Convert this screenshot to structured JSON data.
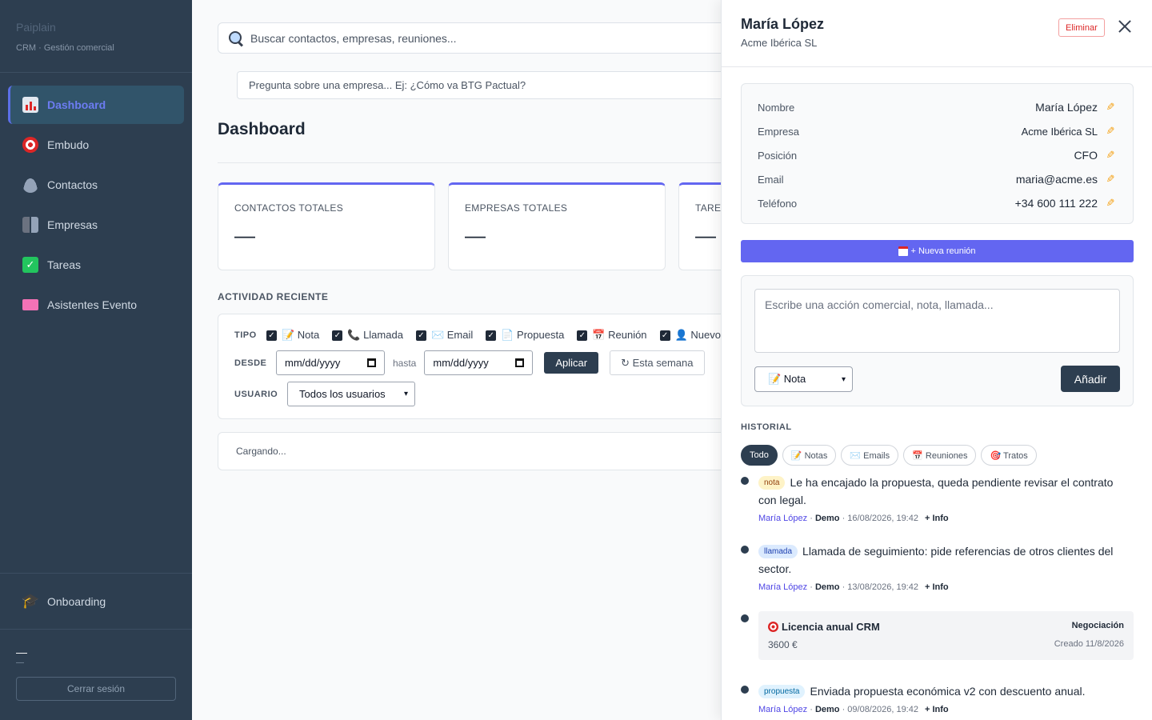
{
  "brand": {
    "title": "Paiplain",
    "subtitle": "CRM · Gestión comercial"
  },
  "sidebar": {
    "items": [
      {
        "label": "Dashboard",
        "icon": "chart-icon",
        "active": true
      },
      {
        "label": "Embudo",
        "icon": "target-icon"
      },
      {
        "label": "Contactos",
        "icon": "person-icon"
      },
      {
        "label": "Empresas",
        "icon": "building-icon"
      },
      {
        "label": "Tareas",
        "icon": "check-icon"
      },
      {
        "label": "Asistentes Evento",
        "icon": "ticket-icon"
      }
    ],
    "onboarding": "Onboarding",
    "user_name": "—",
    "user_role": "—",
    "logout": "Cerrar sesión"
  },
  "search": {
    "placeholder": "Buscar contactos, empresas, reuniones..."
  },
  "ask": {
    "placeholder": "Pregunta sobre una empresa... Ej: ¿Cómo va BTG Pactual?"
  },
  "page": {
    "title": "Dashboard"
  },
  "stats": [
    {
      "label": "CONTACTOS TOTALES",
      "value": "—"
    },
    {
      "label": "EMPRESAS TOTALES",
      "value": "—"
    },
    {
      "label": "TARE",
      "value": "—"
    }
  ],
  "activity": {
    "title": "ACTIVIDAD RECIENTE",
    "tipo_label": "TIPO",
    "types": [
      "📝 Nota",
      "📞 Llamada",
      "✉️ Email",
      "📄 Propuesta",
      "📅 Reunión",
      "👤 Nuevo conta"
    ],
    "desde_label": "DESDE",
    "date_placeholder": "mm/dd/yyyy",
    "hasta_label": "hasta",
    "apply": "Aplicar",
    "this_week": "↻ Esta semana",
    "usuario_label": "USUARIO",
    "usuario_value": "Todos los usuarios",
    "loading": "Cargando..."
  },
  "drawer": {
    "name": "María López",
    "company": "Acme Ibérica SL",
    "delete": "Eliminar",
    "fields": [
      {
        "label": "Nombre",
        "value": "María López"
      },
      {
        "label": "Empresa",
        "value": "Acme Ibérica SL"
      },
      {
        "label": "Posición",
        "value": "CFO"
      },
      {
        "label": "Email",
        "value": "maria@acme.es"
      },
      {
        "label": "Teléfono",
        "value": "+34 600 111 222"
      }
    ],
    "new_meeting": "+ Nueva reunión",
    "note_placeholder": "Escribe una acción comercial, nota, llamada...",
    "note_type": "📝 Nota",
    "add": "Añadir",
    "history_title": "HISTORIAL",
    "filters": [
      "Todo",
      "📝 Notas",
      "✉️ Emails",
      "📅 Reuniones",
      "🎯 Tratos"
    ],
    "events": [
      {
        "badge": "nota",
        "text": "Le ha encajado la propuesta, queda pendiente revisar el contrato con legal.",
        "author": "María López",
        "source": "Demo",
        "date": "· 16/08/2026, 19:42",
        "more": "+ Info"
      },
      {
        "badge": "llamada",
        "text": "Llamada de seguimiento: pide referencias de otros clientes del sector.",
        "author": "María López",
        "source": "Demo",
        "date": "· 13/08/2026, 19:42",
        "more": "+ Info"
      },
      {
        "badge": "propuesta",
        "text": "Enviada propuesta económica v2 con descuento anual.",
        "author": "María López",
        "source": "Demo",
        "date": "· 09/08/2026, 19:42",
        "more": "+ Info"
      }
    ],
    "deal": {
      "title": "Licencia anual CRM",
      "stage": "Negociación",
      "amount": "3600 €",
      "created": "Creado 11/8/2026"
    }
  }
}
